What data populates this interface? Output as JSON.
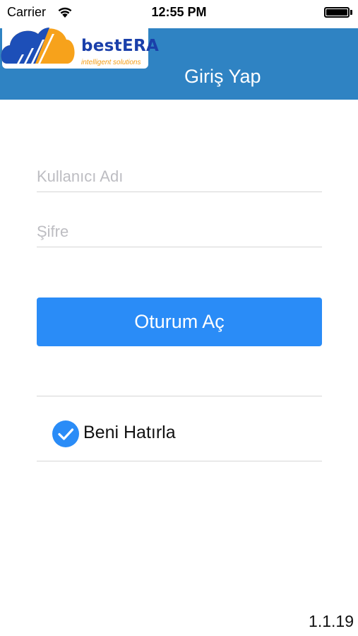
{
  "status_bar": {
    "carrier": "Carrier",
    "time": "12:55 PM",
    "wifi_icon": "wifi-icon",
    "battery_icon": "battery-icon"
  },
  "nav": {
    "logo_name": "bestERA",
    "logo_tagline": "intelligent solutions",
    "title": "Giriş Yap",
    "background_color": "#2f83c3"
  },
  "form": {
    "username_placeholder": "Kullanıcı Adı",
    "username_value": "",
    "password_placeholder": "Şifre",
    "password_value": "",
    "login_button": "Oturum Aç",
    "remember_label": "Beni Hatırla",
    "remember_checked": true,
    "accent_color": "#2a8cf7"
  },
  "footer": {
    "version": "1.1.19"
  }
}
